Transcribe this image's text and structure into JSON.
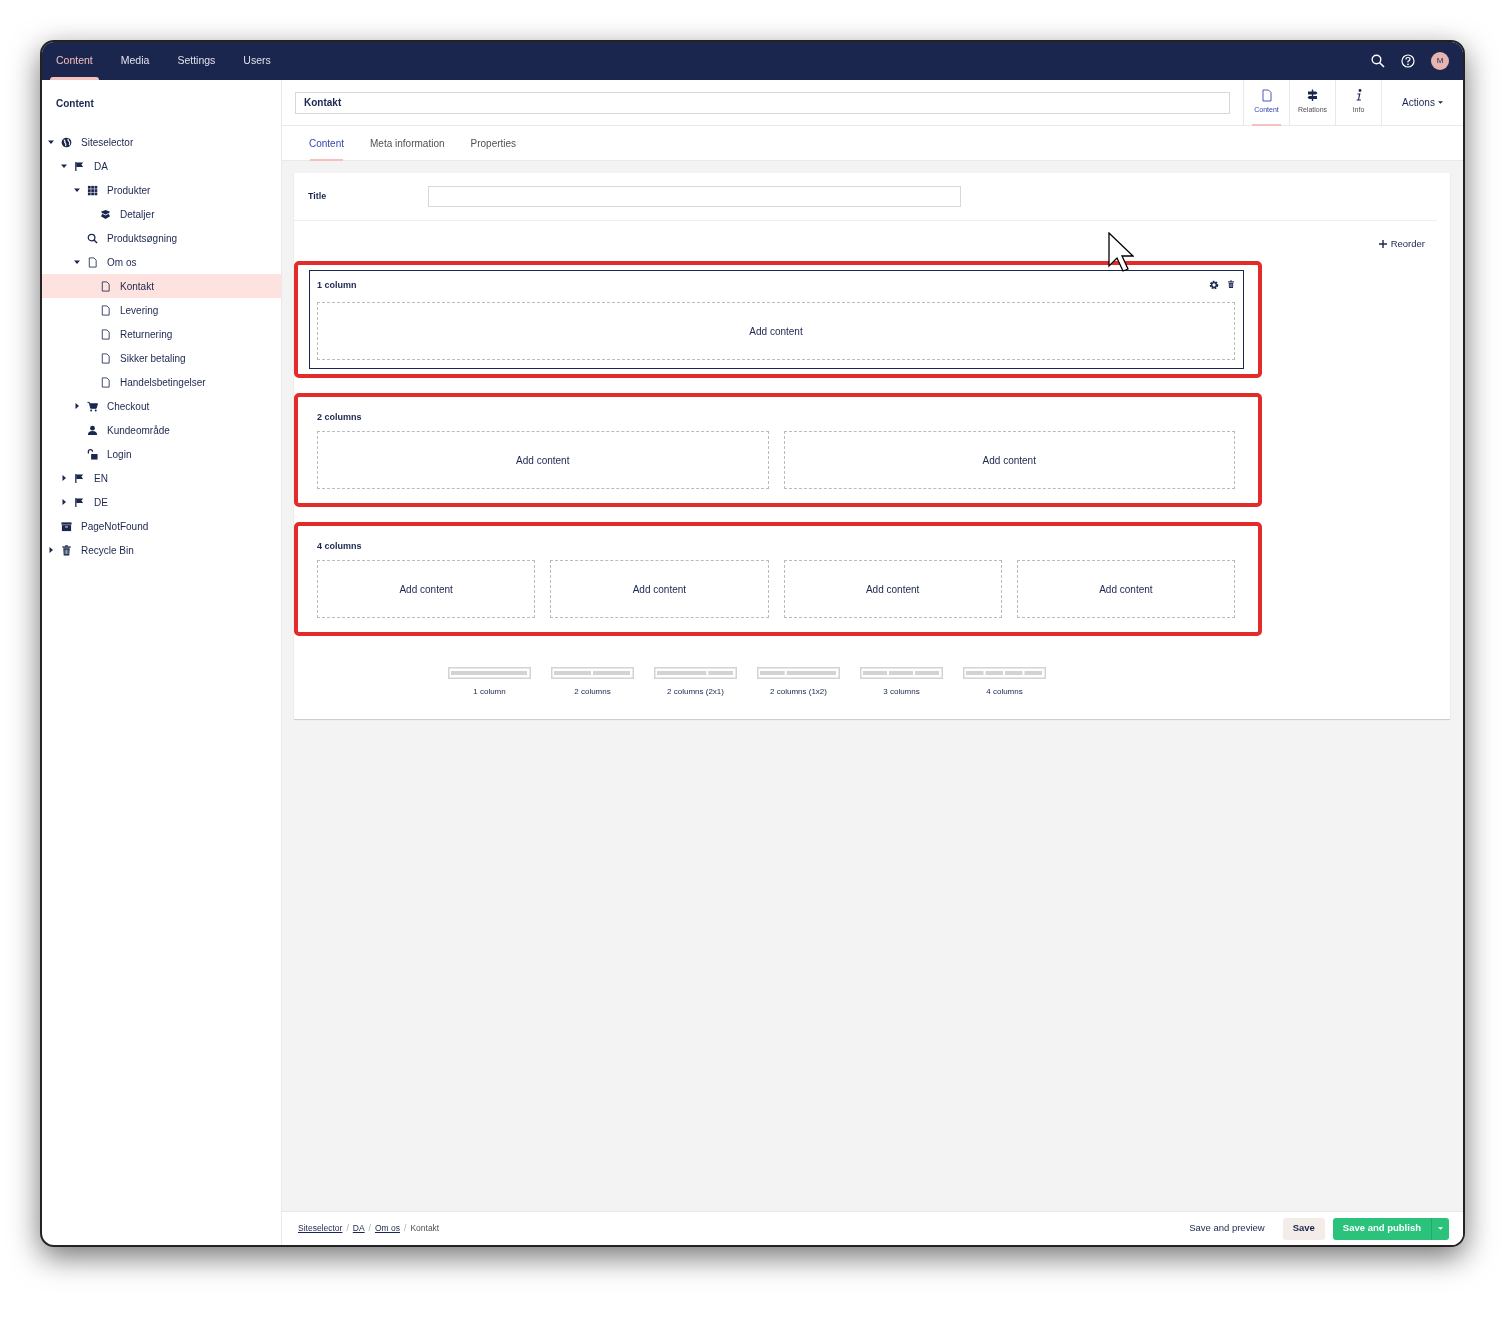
{
  "top_nav": {
    "sections": [
      {
        "label": "Content",
        "selected": true
      },
      {
        "label": "Media",
        "selected": false
      },
      {
        "label": "Settings",
        "selected": false
      },
      {
        "label": "Users",
        "selected": false
      }
    ],
    "avatar": "M"
  },
  "sidebar": {
    "title": "Content",
    "tree": [
      {
        "label": "Siteselector",
        "kind": "root",
        "expanded": true,
        "selected": false,
        "children": [
          {
            "label": "DA",
            "kind": "language",
            "expanded": true,
            "selected": false,
            "children": [
              {
                "label": "Produkter",
                "kind": "catalog",
                "expanded": true,
                "selected": false,
                "children": [
                  {
                    "label": "Detaljer",
                    "kind": "product",
                    "selected": false
                  }
                ]
              },
              {
                "label": "Produktsøgning",
                "kind": "search",
                "selected": false
              },
              {
                "label": "Om os",
                "kind": "page",
                "expanded": true,
                "selected": false,
                "children": [
                  {
                    "label": "Kontakt",
                    "kind": "page",
                    "selected": true
                  },
                  {
                    "label": "Levering",
                    "kind": "page",
                    "selected": false
                  },
                  {
                    "label": "Returnering",
                    "kind": "page",
                    "selected": false
                  },
                  {
                    "label": "Sikker betaling",
                    "kind": "page",
                    "selected": false
                  },
                  {
                    "label": "Handelsbetingelser",
                    "kind": "page",
                    "selected": false
                  }
                ]
              },
              {
                "label": "Checkout",
                "kind": "checkout",
                "expanded": false,
                "selected": false
              },
              {
                "label": "Kundeområde",
                "kind": "account",
                "selected": false
              },
              {
                "label": "Login",
                "kind": "login",
                "selected": false
              }
            ]
          },
          {
            "label": "EN",
            "kind": "language",
            "expanded": false,
            "selected": false
          },
          {
            "label": "DE",
            "kind": "language",
            "expanded": false,
            "selected": false
          }
        ]
      },
      {
        "label": "PageNotFound",
        "kind": "notfound",
        "selected": false
      },
      {
        "label": "Recycle Bin",
        "kind": "recyclebin",
        "expanded": false,
        "selected": false
      }
    ]
  },
  "editor": {
    "name": "Kontakt",
    "apps": [
      {
        "label": "Content",
        "kind": "document",
        "selected": true
      },
      {
        "label": "Relations",
        "kind": "signpost",
        "selected": false
      },
      {
        "label": "Info",
        "kind": "info",
        "selected": false
      }
    ],
    "actions": "Actions",
    "tabs": [
      {
        "label": "Content",
        "selected": true
      },
      {
        "label": "Meta information",
        "selected": false
      },
      {
        "label": "Properties",
        "selected": false
      }
    ],
    "title_label": "Title",
    "reorder": "Reorder",
    "grid_rows": [
      {
        "title": "1 column",
        "selected": true,
        "highlighted": true,
        "cells": [
          "Add content"
        ]
      },
      {
        "title": "2 columns",
        "selected": false,
        "highlighted": true,
        "cells": [
          "Add content",
          "Add content"
        ]
      },
      {
        "title": "4 columns",
        "selected": false,
        "highlighted": true,
        "cells": [
          "Add content",
          "Add content",
          "Add content",
          "Add content"
        ]
      }
    ],
    "layouts": [
      {
        "label": "1 column",
        "kind": "one"
      },
      {
        "label": "2 columns",
        "kind": "two"
      },
      {
        "label": "2 columns (2x1)",
        "kind": "wideleft"
      },
      {
        "label": "2 columns (1x2)",
        "kind": "wideright"
      },
      {
        "label": "3 columns",
        "kind": "three"
      },
      {
        "label": "4 columns",
        "kind": "four"
      }
    ]
  },
  "footer": {
    "breadcrumbs": [
      {
        "label": "Siteselector",
        "link": true
      },
      {
        "label": "DA",
        "link": true
      },
      {
        "label": "Om os",
        "link": true
      },
      {
        "label": "Kontakt",
        "link": false
      }
    ],
    "separator": "/",
    "save_preview": "Save and preview",
    "save": "Save",
    "publish": "Save and publish"
  }
}
